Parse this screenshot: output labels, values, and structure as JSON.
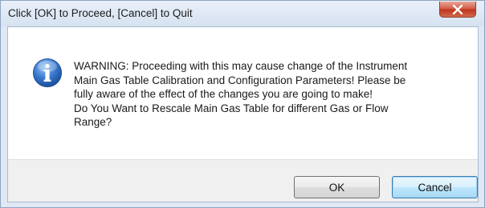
{
  "dialog": {
    "title": "Click [OK] to Proceed, [Cancel] to Quit",
    "icon": "information-icon",
    "message_lines": [
      "WARNING: Proceeding with this may cause change of the Instrument",
      "Main Gas Table Calibration and Configuration Parameters! Please be",
      "fully aware of the effect of the changes  you are going to make!",
      "Do You Want to Rescale Main Gas Table for different Gas or Flow",
      "Range?"
    ],
    "ok_label": "OK",
    "cancel_label": "Cancel",
    "close_icon": "close-icon"
  },
  "colors": {
    "close_button": "#c7442a",
    "info_icon": "#2f6cc0",
    "default_button_border": "#3c7fb1"
  }
}
